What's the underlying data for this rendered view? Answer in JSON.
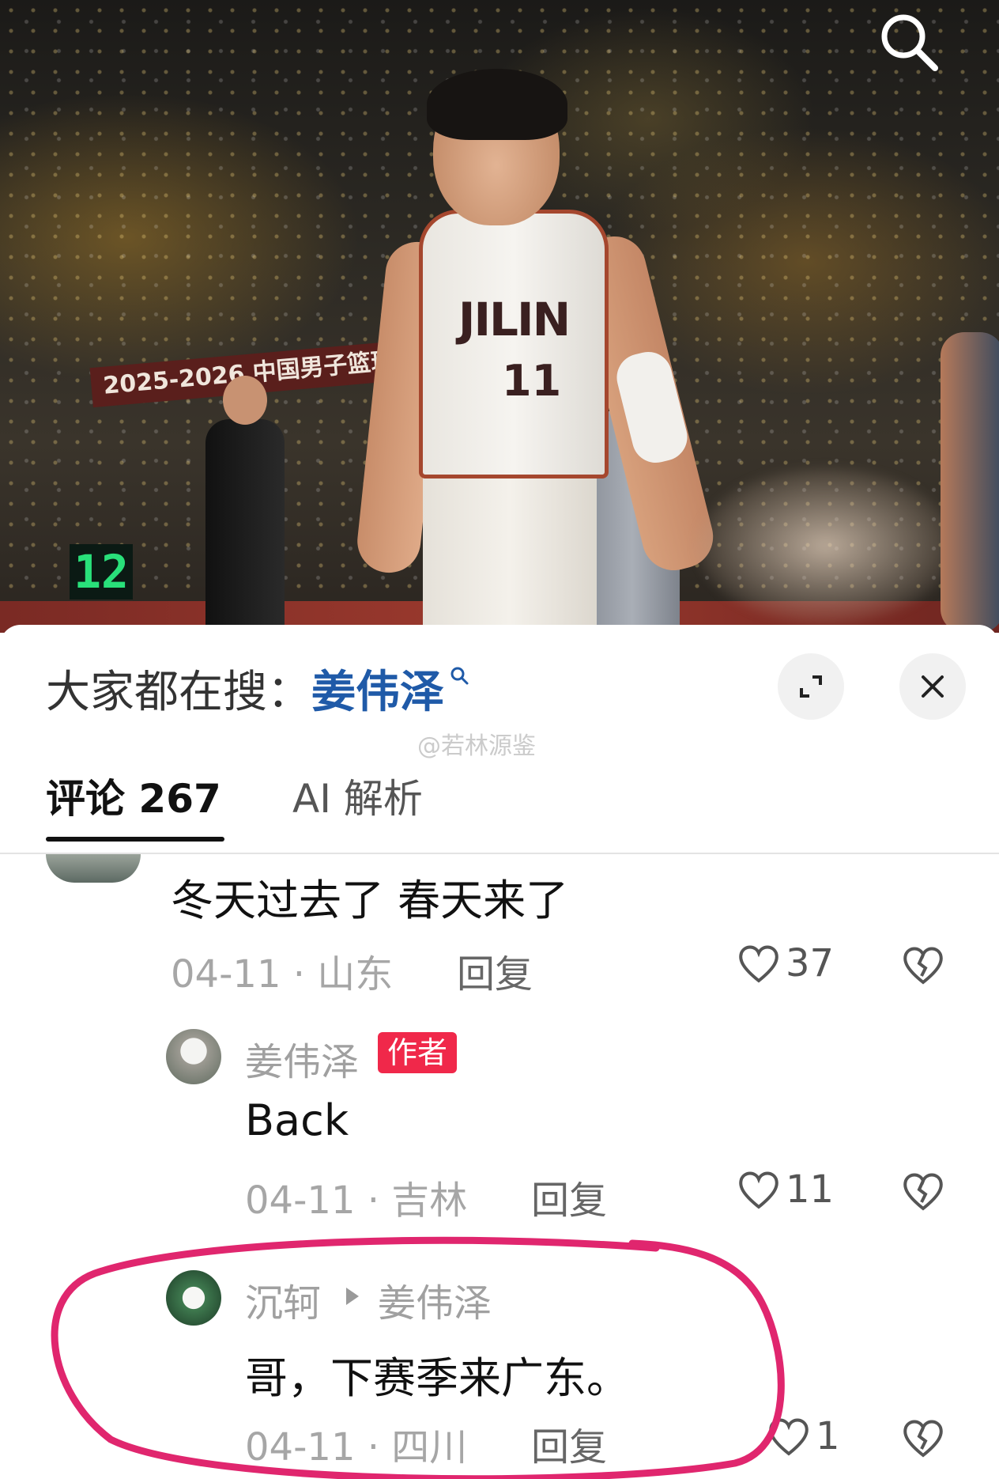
{
  "video": {
    "banner_text": "2025-2026 中国男子篮球",
    "scoreboard_value": "12",
    "jersey_team_text": "JILIN",
    "jersey_number": "11"
  },
  "search_bar": {
    "prefix": "大家都在搜：",
    "term": "姜伟泽"
  },
  "watermark": "@若林源鉴",
  "tabs": [
    {
      "label": "评论 267"
    },
    {
      "label": "AI 解析"
    }
  ],
  "comments": [
    {
      "text": "冬天过去了  春天来了",
      "date_location": "04-11 · 山东",
      "reply_label": "回复",
      "likes": "37"
    },
    {
      "username": "姜伟泽",
      "badge": "作者",
      "text": "Back",
      "date_location": "04-11 · 吉林",
      "reply_label": "回复",
      "likes": "11"
    },
    {
      "username": "沉轲",
      "reply_to": "姜伟泽",
      "text": "哥，下赛季来广东。",
      "date_location": "04-11 · 四川",
      "reply_label": "回复",
      "likes": "1"
    }
  ],
  "colors": {
    "search_term": "#1f5aa8",
    "author_badge": "#f0284a",
    "highlight_circle": "#e0266e"
  }
}
